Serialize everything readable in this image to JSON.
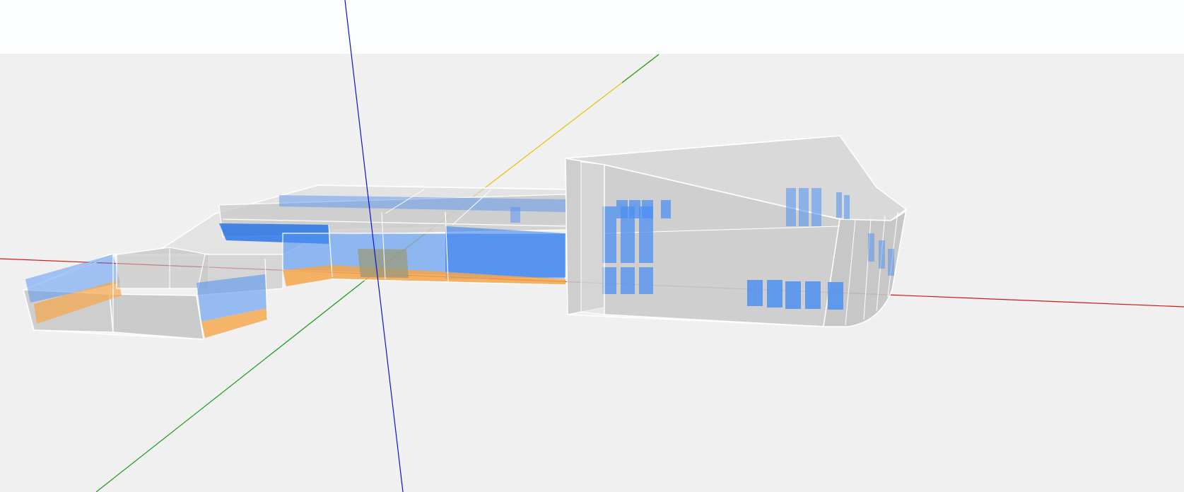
{
  "viewport": {
    "kind": "3d-model-viewer",
    "background": {
      "sky_color": "#fdfeff",
      "ground_color": "#f0f0f0"
    },
    "axes": [
      {
        "name": "x-axis",
        "color": "#d01818"
      },
      {
        "name": "y-axis",
        "color": "#1a9a1a",
        "positive_color": "#e8c000"
      },
      {
        "name": "z-axis",
        "color": "#1010d0"
      }
    ],
    "model": {
      "surface_colors": {
        "wall": "#cfcfcf",
        "window": "#4d8ff2",
        "floor": "#f5a64a",
        "door": "#9a9a7a",
        "edge": "#ffffff"
      }
    }
  }
}
